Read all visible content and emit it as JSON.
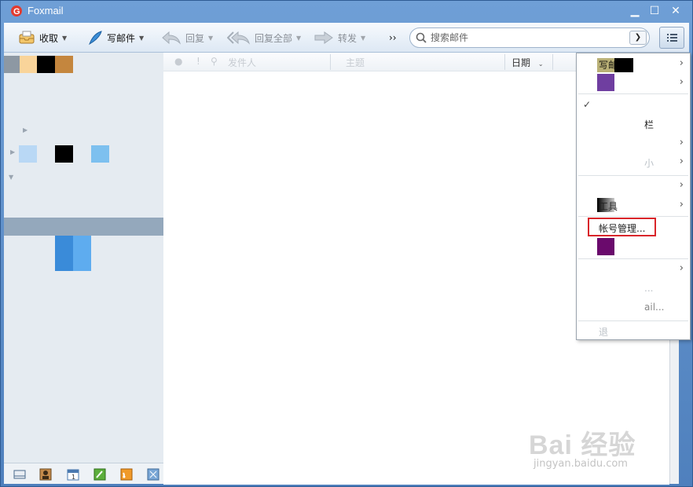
{
  "app": {
    "title": "Foxmail"
  },
  "toolbar": {
    "receive_label": "收取",
    "compose_label": "写邮件",
    "reply_label": "回复",
    "reply_all_label": "回复全部",
    "forward_label": "转发",
    "more_label": "››",
    "search_placeholder": "搜索邮件"
  },
  "list_header": {
    "from_label": "发件人",
    "subject_label": "主题",
    "date_label": "日期"
  },
  "context_menu": {
    "items": [
      {
        "label": "写邮件"
      },
      {
        "label": "账号管理..."
      },
      {
        "label": "栏"
      },
      {
        "label": "小"
      },
      {
        "label": "工具"
      },
      {
        "label": "...",
        "partial": true
      },
      {
        "label": "ail..."
      },
      {
        "label": "退"
      }
    ],
    "highlighted_label": "帐号管理..."
  },
  "watermark": {
    "text": "Bai 经验",
    "url": "jingyan.baidu.com"
  },
  "colors": {
    "accent": "#4f80bd",
    "highlight": "#d9252a",
    "selected_folder": "#94a8bc"
  }
}
